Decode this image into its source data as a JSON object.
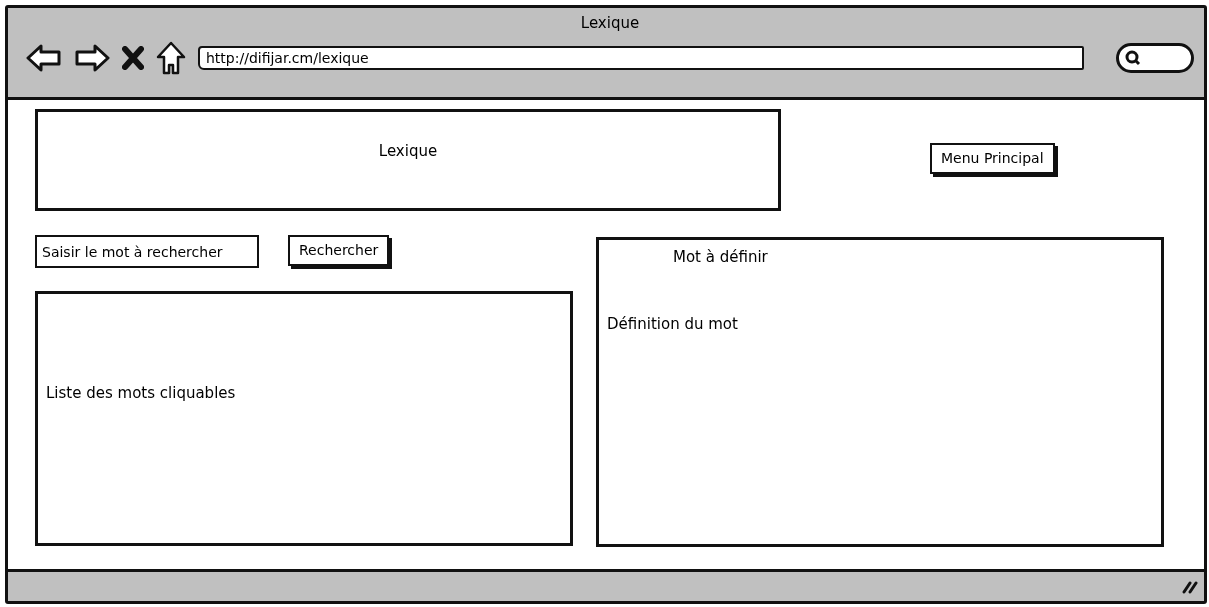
{
  "window": {
    "title": "Lexique"
  },
  "browser": {
    "url": "http://difijar.cm/lexique"
  },
  "header": {
    "title": "Lexique"
  },
  "menu_button": {
    "label": "Menu Principal"
  },
  "search": {
    "value": "Saisir le mot à rechercher",
    "button": "Rechercher"
  },
  "word_list": {
    "text": "Liste des mots cliquables"
  },
  "definition": {
    "word": "Mot à définir",
    "text": "Définition du mot"
  }
}
